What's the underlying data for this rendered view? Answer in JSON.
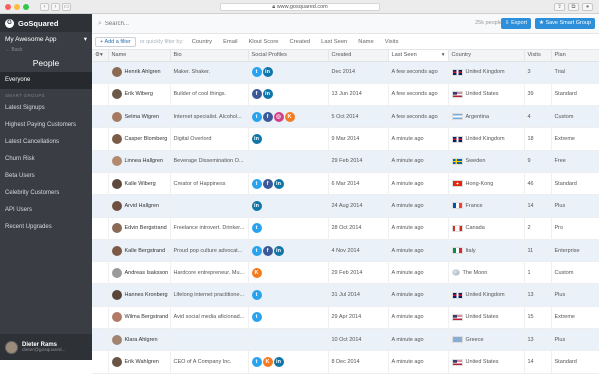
{
  "browser": {
    "url": "www.gosquared.com"
  },
  "sidebar": {
    "brand": "GoSquared",
    "project": "My Awesome App",
    "back": "Back",
    "title": "People",
    "everyone": "Everyone",
    "section": "SMART GROUPS",
    "groups": [
      "Latest Signups",
      "Highest Paying Customers",
      "Latest Cancellations",
      "Churn Risk",
      "Beta Users",
      "Celebrity Customers",
      "API Users",
      "Recent Upgrades"
    ],
    "user_name": "Dieter Rams",
    "user_email": "dieter@gosquared..."
  },
  "search": {
    "placeholder": "Search..."
  },
  "people_count": "25k people",
  "buttons": {
    "export": "Export",
    "save": "Save Smart Group"
  },
  "filter": {
    "add": "Add a filter",
    "hint": "or quickly filter by:",
    "fields": [
      "Country",
      "Email",
      "Klout Score",
      "Created",
      "Last Seen",
      "Name",
      "Visits"
    ]
  },
  "columns": [
    "Name",
    "Bio",
    "Social Profiles",
    "Created",
    "Last Seen",
    "Country",
    "Visits",
    "Plan"
  ],
  "colors": {
    "twitter": "#2aa3ef",
    "facebook": "#3b5998",
    "linkedin": "#0e76a8",
    "instagram": "#d23f86",
    "klout": "#f47b20",
    "accent": "#2d8ed9",
    "sidebar": "#3a3d43"
  },
  "rows": [
    {
      "name": "Henrik Ahlgren",
      "bio": "Maker. Shaker.",
      "social": [
        "twitter",
        "linkedin"
      ],
      "created": "Dec 2014",
      "last_seen": "A few seconds ago",
      "country": "United Kingdom",
      "flag": "gb",
      "visits": "3",
      "plan": "Trial",
      "avatar": "#8b6b52"
    },
    {
      "name": "Erik Wiberg",
      "bio": "Builder of cool things.",
      "social": [
        "facebook",
        "linkedin"
      ],
      "created": "13 Jun 2014",
      "last_seen": "A few seconds ago",
      "country": "United States",
      "flag": "us",
      "visits": "39",
      "plan": "Standard",
      "avatar": "#6b5a4a"
    },
    {
      "name": "Selma Wigren",
      "bio": "Internet specialist. Alcohol...",
      "social": [
        "twitter",
        "facebook",
        "instagram",
        "klout"
      ],
      "created": "5 Oct 2014",
      "last_seen": "A few seconds ago",
      "country": "Argentina",
      "flag": "ar",
      "visits": "4",
      "plan": "Custom",
      "avatar": "#a57a60"
    },
    {
      "name": "Casper Blomberg",
      "bio": "Digital Overlord",
      "social": [
        "linkedin"
      ],
      "created": "9 Mar 2014",
      "last_seen": "A minute ago",
      "country": "United Kingdom",
      "flag": "gb",
      "visits": "18",
      "plan": "Extreme",
      "avatar": "#7a5c48"
    },
    {
      "name": "Linnea Hallgren",
      "bio": "Beverage Dissemination O...",
      "social": [],
      "created": "29 Feb 2014",
      "last_seen": "A minute ago",
      "country": "Sweden",
      "flag": "se",
      "visits": "9",
      "plan": "Free",
      "avatar": "#b48a6e"
    },
    {
      "name": "Kalle Wiberg",
      "bio": "Creator of Happiness",
      "social": [
        "twitter",
        "facebook",
        "linkedin"
      ],
      "created": "6 Mar 2014",
      "last_seen": "A minute ago",
      "country": "Hong-Kong",
      "flag": "hk",
      "visits": "46",
      "plan": "Standard",
      "avatar": "#5e4a3c"
    },
    {
      "name": "Arvid Hallgren",
      "bio": "",
      "social": [
        "linkedin"
      ],
      "created": "24 Aug 2014",
      "last_seen": "A minute ago",
      "country": "France",
      "flag": "fr",
      "visits": "14",
      "plan": "Plus",
      "avatar": "#6e5040"
    },
    {
      "name": "Edvin Bergstrand",
      "bio": "Freelance introvert. Drinker...",
      "social": [
        "twitter"
      ],
      "created": "28 Oct 2014",
      "last_seen": "A minute ago",
      "country": "Canada",
      "flag": "ca",
      "visits": "2",
      "plan": "Pro",
      "avatar": "#8a6a55"
    },
    {
      "name": "Kalle Bergstrand",
      "bio": "Proud pop culture advocat...",
      "social": [
        "twitter",
        "facebook",
        "linkedin"
      ],
      "created": "4 Nov 2014",
      "last_seen": "A minute ago",
      "country": "Italy",
      "flag": "it",
      "visits": "11",
      "plan": "Enterprise",
      "avatar": "#7c5a46"
    },
    {
      "name": "Andreas Isaksson",
      "bio": "Hardcore entrepreneur. Mu...",
      "social": [
        "klout"
      ],
      "created": "29 Feb 2014",
      "last_seen": "A minute ago",
      "country": "The Moon",
      "flag": "moon",
      "visits": "1",
      "plan": "Custom",
      "avatar": "#9a9a9a"
    },
    {
      "name": "Hannes Kronberg",
      "bio": "Lifelong internet practitione...",
      "social": [
        "twitter"
      ],
      "created": "31 Jul 2014",
      "last_seen": "A minute ago",
      "country": "United Kingdom",
      "flag": "gb",
      "visits": "13",
      "plan": "Plus",
      "avatar": "#5a4638"
    },
    {
      "name": "Wilma Bergstrand",
      "bio": "Avid social media aficionad...",
      "social": [
        "twitter"
      ],
      "created": "29 Apr 2014",
      "last_seen": "A minute ago",
      "country": "United States",
      "flag": "us",
      "visits": "15",
      "plan": "Extreme",
      "avatar": "#b07a66"
    },
    {
      "name": "Klara Ahlgren",
      "bio": "",
      "social": [],
      "created": "10 Oct 2014",
      "last_seen": "A minute ago",
      "country": "Greece",
      "flag": "gr",
      "visits": "13",
      "plan": "Plus",
      "avatar": "#a38470"
    },
    {
      "name": "Erik Wahlgren",
      "bio": "CEO of A Company Inc.",
      "social": [
        "twitter",
        "klout",
        "linkedin"
      ],
      "created": "8 Dec 2014",
      "last_seen": "A minute ago",
      "country": "United States",
      "flag": "us",
      "visits": "14",
      "plan": "Standard",
      "avatar": "#6a5444"
    }
  ]
}
